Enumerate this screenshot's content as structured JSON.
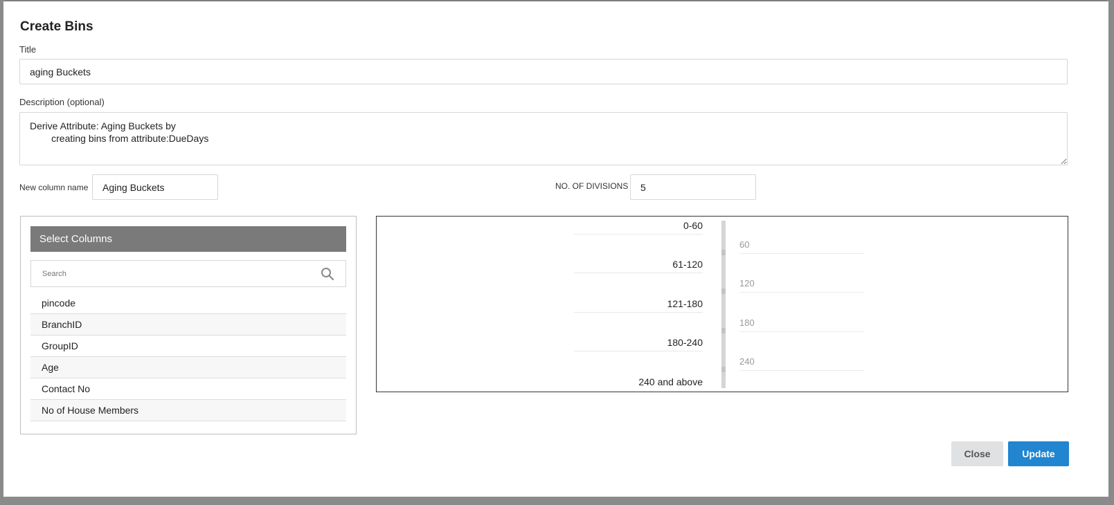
{
  "modal": {
    "title": "Create Bins",
    "title_label": "Title",
    "title_value": "aging Buckets",
    "description_label": "Description (optional)",
    "description_value": "Derive Attribute: Aging Buckets by\n        creating bins from attribute:DueDays",
    "new_column_label": "New column name",
    "new_column_value": "Aging Buckets",
    "divisions_label": "NO. OF DIVISIONS",
    "divisions_value": "5"
  },
  "columns_panel": {
    "header": "Select Columns",
    "search_placeholder": "Search",
    "search_icon": "search-icon",
    "items": [
      "pincode",
      "BranchID",
      "GroupID",
      "Age",
      "Contact No",
      "No of House Members"
    ]
  },
  "bins": {
    "labels": [
      "0-60",
      "61-120",
      "121-180",
      "180-240",
      "240 and above"
    ],
    "boundaries": [
      "60",
      "120",
      "180",
      "240"
    ]
  },
  "footer": {
    "close_label": "Close",
    "update_label": "Update"
  },
  "colors": {
    "primary": "#2185d0",
    "header_gray": "#7a7a7a",
    "overlay": "#7d7d7d"
  }
}
